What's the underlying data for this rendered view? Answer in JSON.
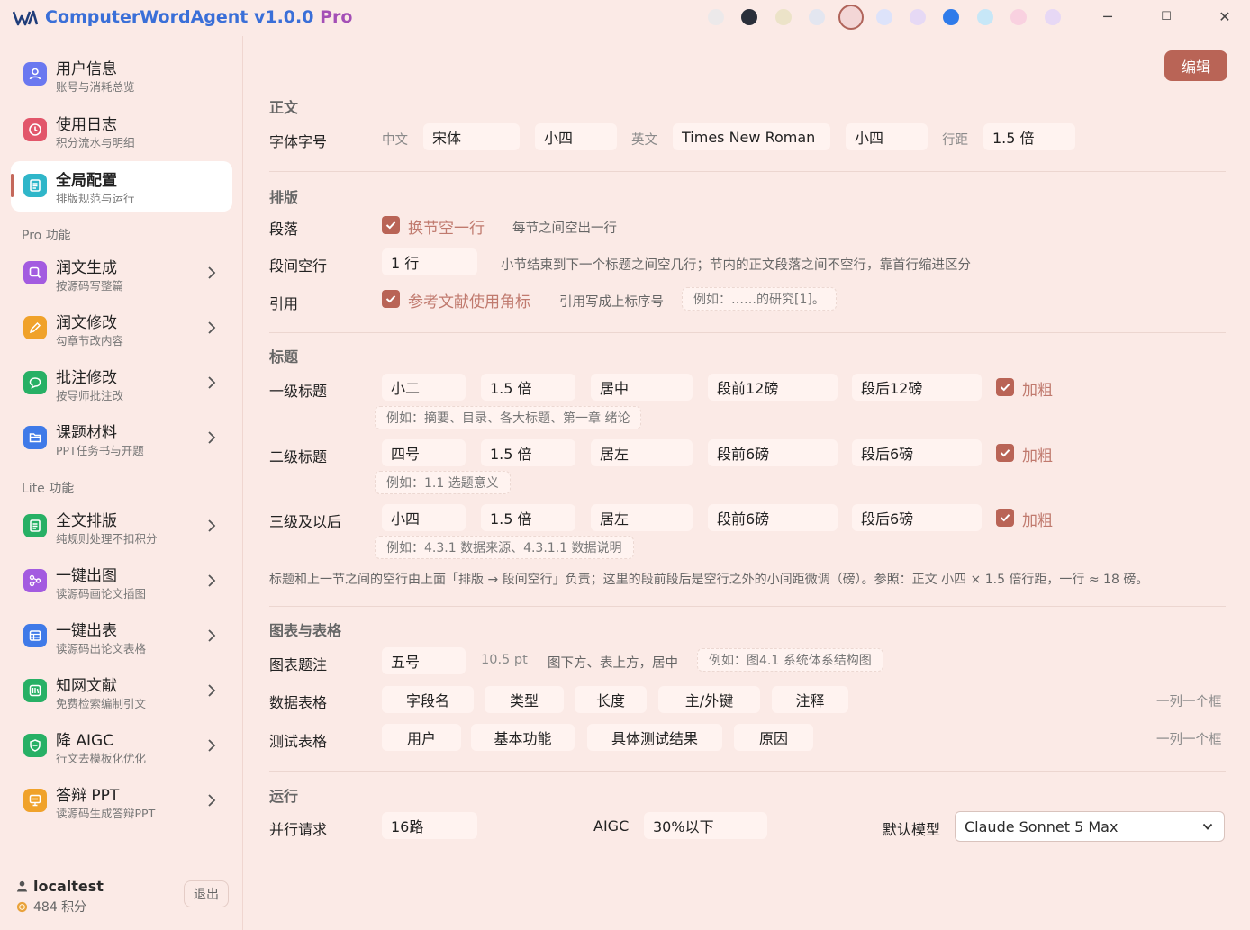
{
  "app": {
    "title_main": "ComputerWordAgent v1.0.0",
    "title_pro": "Pro"
  },
  "theme_swatches": [
    "#ece9ea",
    "#2a2f3a",
    "#ece3c8",
    "#e3e6f0",
    "#f3d6d6",
    "#dde3fa",
    "#e6d9f5",
    "#2f7bea",
    "#c7e7f7",
    "#f9d1e0",
    "#e7d8f5"
  ],
  "window_controls": {
    "minimize": "─",
    "maximize": "☐",
    "close": "✕"
  },
  "sidebar": {
    "items": [
      {
        "title": "用户信息",
        "sub": "账号与消耗总览",
        "color": "#6a78f0"
      },
      {
        "title": "使用日志",
        "sub": "积分流水与明细",
        "color": "#e2566a"
      },
      {
        "title": "全局配置",
        "sub": "排版规范与运行",
        "color": "#2fb6c9"
      }
    ],
    "pro_label": "Pro 功能",
    "pro_items": [
      {
        "title": "润文生成",
        "sub": "按源码写整篇",
        "color": "#a35be0"
      },
      {
        "title": "润文修改",
        "sub": "勾章节改内容",
        "color": "#f0a22a"
      },
      {
        "title": "批注修改",
        "sub": "按导师批注改",
        "color": "#27b065"
      },
      {
        "title": "课题材料",
        "sub": "PPT任务书与开题",
        "color": "#3f7ae8"
      }
    ],
    "lite_label": "Lite 功能",
    "lite_items": [
      {
        "title": "全文排版",
        "sub": "纯规则处理不扣积分",
        "color": "#27b065"
      },
      {
        "title": "一键出图",
        "sub": "读源码画论文插图",
        "color": "#a35be0"
      },
      {
        "title": "一键出表",
        "sub": "读源码出论文表格",
        "color": "#3f7ae8"
      },
      {
        "title": "知网文献",
        "sub": "免费检索编制引文",
        "color": "#27b065"
      },
      {
        "title": "降 AIGC",
        "sub": "行文去模板化优化",
        "color": "#27b065"
      },
      {
        "title": "答辩 PPT",
        "sub": "读源码生成答辩PPT",
        "color": "#f0a22a"
      }
    ]
  },
  "user": {
    "name": "localtest",
    "credits": "484 积分",
    "logout": "退出"
  },
  "edit_button": "编辑",
  "body_text": {
    "section": "正文",
    "font_label": "字体字号",
    "zh_label": "中文",
    "zh_font": "宋体",
    "zh_size": "小四",
    "en_label": "英文",
    "en_font": "Times New Roman",
    "en_size": "小四",
    "spacing_label": "行距",
    "spacing": "1.5 倍"
  },
  "layout": {
    "section": "排版",
    "paragraph_label": "段落",
    "paragraph_cb": "换节空一行",
    "paragraph_hint": "每节之间空出一行",
    "gap_label": "段间空行",
    "gap_value": "1 行",
    "gap_hint": "小节结束到下一个标题之间空几行；节内的正文段落之间不空行，靠首行缩进区分",
    "cite_label": "引用",
    "cite_cb": "参考文献使用角标",
    "cite_hint": "引用写成上标序号",
    "cite_example": "例如：……的研究[1]。"
  },
  "headings": {
    "section": "标题",
    "rows": [
      {
        "label": "一级标题",
        "size": "小二",
        "spacing": "1.5 倍",
        "align": "居中",
        "before": "段前12磅",
        "after": "段后12磅",
        "bold": "加粗",
        "example": "例如：摘要、目录、各大标题、第一章 绪论"
      },
      {
        "label": "二级标题",
        "size": "四号",
        "spacing": "1.5 倍",
        "align": "居左",
        "before": "段前6磅",
        "after": "段后6磅",
        "bold": "加粗",
        "example": "例如：1.1 选题意义"
      },
      {
        "label": "三级及以后",
        "size": "小四",
        "spacing": "1.5 倍",
        "align": "居左",
        "before": "段前6磅",
        "after": "段后6磅",
        "bold": "加粗",
        "example": "例如：4.3.1 数据来源、4.3.1.1 数据说明"
      }
    ],
    "note": "标题和上一节之间的空行由上面「排版 → 段间空行」负责；这里的段前段后是空行之外的小间距微调（磅）。参照：正文 小四 × 1.5 倍行距，一行 ≈ 18 磅。"
  },
  "figures": {
    "section": "图表与表格",
    "caption_label": "图表题注",
    "caption_size": "五号",
    "caption_pt": "10.5 pt",
    "caption_hint": "图下方、表上方，居中",
    "caption_example": "例如：图4.1 系统体系结构图",
    "data_table_label": "数据表格",
    "data_table_cols": [
      "字段名",
      "类型",
      "长度",
      "主/外键",
      "注释"
    ],
    "data_table_hint": "一列一个框",
    "test_table_label": "测试表格",
    "test_table_cols": [
      "用户",
      "基本功能",
      "具体测试结果",
      "原因"
    ],
    "test_table_hint": "一列一个框"
  },
  "run": {
    "section": "运行",
    "parallel_label": "并行请求",
    "parallel_value": "16路",
    "aigc_label": "AIGC",
    "aigc_value": "30%以下",
    "model_label": "默认模型",
    "model_value": "Claude Sonnet 5 Max"
  }
}
